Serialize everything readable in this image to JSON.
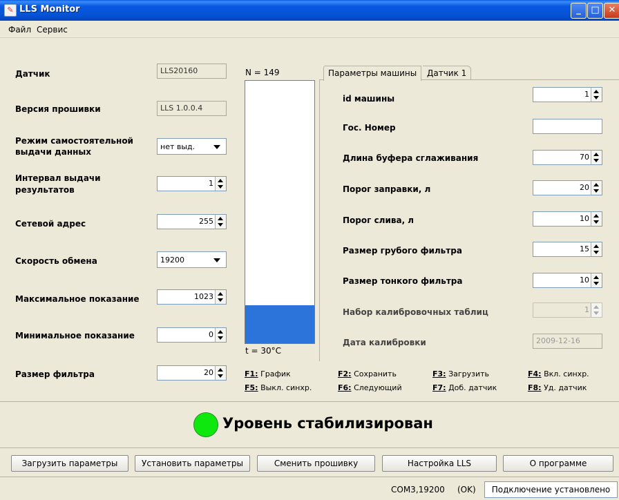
{
  "window": {
    "title": "LLS Monitor"
  },
  "menu": {
    "items": [
      "Файл",
      "Сервис"
    ]
  },
  "left": {
    "sensor_label": "Датчик",
    "sensor_value": "LLS20160",
    "firmware_label": "Версия прошивки",
    "firmware_value": "LLS 1.0.0.4",
    "mode_label_1": "Режим самостоятельной",
    "mode_label_2": "выдачи данных",
    "mode_value": "нет выд.",
    "interval_label_1": "Интервал выдачи",
    "interval_label_2": "результатов",
    "interval_value": "1",
    "address_label": "Сетевой адрес",
    "address_value": "255",
    "speed_label": "Скорость обмена",
    "speed_value": "19200",
    "max_label": "Максимальное показание",
    "max_value": "1023",
    "min_label": "Минимальное показание",
    "min_value": "0",
    "filter_label": "Размер фильтра",
    "filter_value": "20"
  },
  "gauge": {
    "n_label": "N = 149",
    "temp_label": "t = 30°C",
    "fill_fraction": 0.145,
    "fill_color": "#2D74DA"
  },
  "tabs": [
    {
      "label": "Параметры машины",
      "active": true
    },
    {
      "label": "Датчик 1",
      "active": false
    }
  ],
  "car": {
    "id_label": "id машины",
    "id_value": "1",
    "plate_label": "Гос. Номер",
    "plate_value": "",
    "buffer_label": "Длина буфера сглаживания",
    "buffer_value": "70",
    "refuel_label": "Порог заправки, л",
    "refuel_value": "20",
    "drain_label": "Порог слива, л",
    "drain_value": "10",
    "coarse_label": "Размер грубого фильтра",
    "coarse_value": "15",
    "fine_label": "Размер тонкого фильтра",
    "fine_value": "10",
    "calib_set_label": "Набор калибровочных таблиц",
    "calib_set_value": "1",
    "calib_date_label": "Дата калибровки",
    "calib_date_value": "2009-12-16"
  },
  "fkeys": [
    {
      "key": "F1:",
      "text": " График"
    },
    {
      "key": "F2:",
      "text": " Сохранить"
    },
    {
      "key": "F3:",
      "text": " Загрузить"
    },
    {
      "key": "F4:",
      "text": " Вкл. синхр."
    },
    {
      "key": "F5:",
      "text": " Выкл. синхр."
    },
    {
      "key": "F6:",
      "text": " Следующий"
    },
    {
      "key": "F7:",
      "text": " Доб. датчик"
    },
    {
      "key": "F8:",
      "text": " Уд. датчик"
    }
  ],
  "status": {
    "text": "Уровень стабилизирован",
    "led_color": "#0FE80F"
  },
  "buttons": {
    "load": "Загрузить параметры",
    "set": "Установить параметры",
    "firmware": "Сменить прошивку",
    "settings": "Настройка LLS",
    "about": "О программе"
  },
  "statusbar": {
    "port": "COM3,19200",
    "ok": "(OK)",
    "connection": "Подключение установлено"
  }
}
